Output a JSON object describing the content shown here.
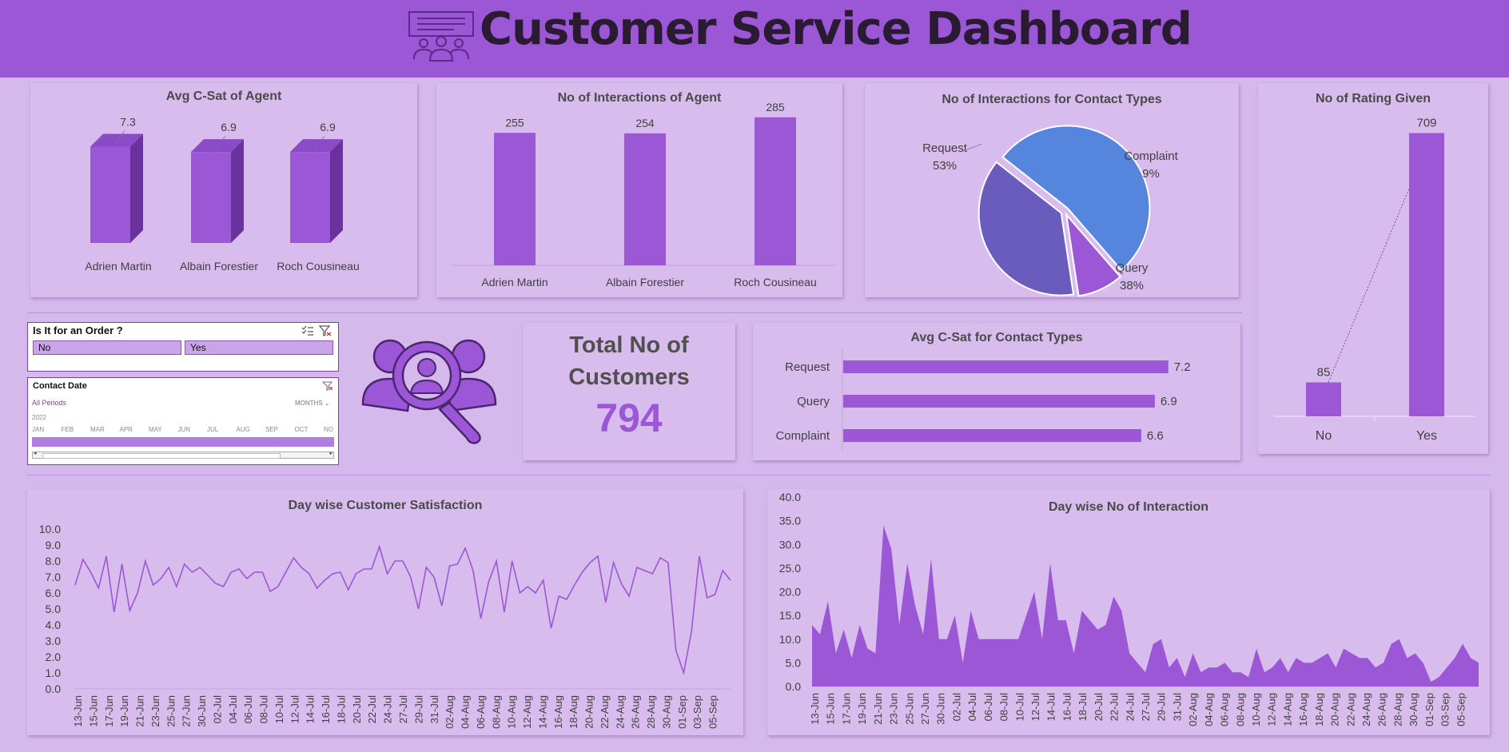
{
  "header": {
    "title": "Customer Service Dashboard",
    "logo_icon": "customer-service-icon"
  },
  "colors": {
    "header": "#9b57d6",
    "background": "#d6b9ec",
    "bar": "#9b57d6",
    "request": "#5585dc",
    "query": "#6a5cbc",
    "complaint": "#9b57d6"
  },
  "csat_agent": {
    "title": "Avg C-Sat of  Agent",
    "chart_data": {
      "type": "bar",
      "categories": [
        "Adrien Martin",
        "Albain Forestier",
        "Roch Cousineau"
      ],
      "values": [
        7.3,
        6.9,
        6.9
      ],
      "labels": [
        "7.3",
        "6.9",
        "6.9"
      ]
    }
  },
  "interactions_agent": {
    "title": "No of Interactions of  Agent",
    "chart_data": {
      "type": "bar",
      "categories": [
        "Adrien Martin",
        "Albain Forestier",
        "Roch Cousineau"
      ],
      "values": [
        255,
        254,
        285
      ],
      "labels": [
        "255",
        "254",
        "285"
      ]
    }
  },
  "contact_types": {
    "title": "No of Interactions for Contact Types",
    "chart_data": {
      "type": "pie",
      "slices": [
        {
          "name": "Request",
          "pct": 53,
          "label": "53%"
        },
        {
          "name": "Complaint",
          "pct": 9,
          "label": "9%"
        },
        {
          "name": "Query",
          "pct": 38,
          "label": "38%"
        }
      ]
    }
  },
  "rating": {
    "title": "No of Rating Given",
    "chart_data": {
      "type": "bar",
      "categories": [
        "No",
        "Yes"
      ],
      "values": [
        85,
        709
      ],
      "labels": [
        "85",
        "709"
      ]
    }
  },
  "order_slicer": {
    "title": "Is It for an Order ?",
    "options": [
      "No",
      "Yes"
    ]
  },
  "date_slicer": {
    "title": "Contact Date",
    "all_periods": "All Periods",
    "level": "MONTHS",
    "year": "2022",
    "months": [
      "JAN",
      "FEB",
      "MAR",
      "APR",
      "MAY",
      "JUN",
      "JUL",
      "AUG",
      "SEP",
      "OCT",
      "NO"
    ]
  },
  "kpi": {
    "line1": "Total  No of",
    "line2": "Customers",
    "value": "794",
    "icon": "customer-search-icon"
  },
  "csat_contact": {
    "title": "Avg C-Sat for Contact Types",
    "chart_data": {
      "type": "bar",
      "categories": [
        "Request",
        "Query",
        "Complaint"
      ],
      "values": [
        7.2,
        6.9,
        6.6
      ],
      "labels": [
        "7.2",
        "6.9",
        "6.6"
      ]
    }
  },
  "day_csat": {
    "title": "Day wise Customer Satisfaction",
    "chart_data": {
      "type": "line",
      "ylim": [
        0,
        10
      ],
      "y_ticks": [
        "10.0",
        "9.0",
        "8.0",
        "7.0",
        "6.0",
        "5.0",
        "4.0",
        "3.0",
        "2.0",
        "1.0",
        "0.0"
      ],
      "x_ticks": [
        "13-Jun",
        "15-Jun",
        "17-Jun",
        "19-Jun",
        "21-Jun",
        "23-Jun",
        "25-Jun",
        "27-Jun",
        "30-Jun",
        "02-Jul",
        "04-Jul",
        "06-Jul",
        "08-Jul",
        "10-Jul",
        "12-Jul",
        "14-Jul",
        "16-Jul",
        "18-Jul",
        "20-Jul",
        "22-Jul",
        "24-Jul",
        "27-Jul",
        "29-Jul",
        "31-Jul",
        "02-Aug",
        "04-Aug",
        "06-Aug",
        "08-Aug",
        "10-Aug",
        "12-Aug",
        "14-Aug",
        "16-Aug",
        "18-Aug",
        "20-Aug",
        "22-Aug",
        "24-Aug",
        "26-Aug",
        "28-Aug",
        "30-Aug",
        "01-Sep",
        "03-Sep",
        "05-Sep"
      ],
      "values": [
        6.5,
        8.1,
        7.3,
        6.3,
        8.3,
        4.8,
        7.8,
        4.9,
        6.0,
        8.0,
        6.5,
        6.9,
        7.6,
        6.4,
        7.8,
        7.3,
        7.6,
        7.1,
        6.6,
        6.4,
        7.3,
        7.5,
        6.9,
        7.3,
        7.3,
        6.1,
        6.4,
        7.3,
        8.2,
        7.6,
        7.2,
        6.3,
        6.8,
        7.2,
        7.3,
        6.2,
        7.2,
        7.5,
        7.5,
        8.9,
        7.2,
        8.0,
        8.0,
        7.0,
        5.0,
        7.6,
        7.0,
        5.2,
        7.7,
        7.8,
        8.8,
        7.4,
        4.4,
        6.7,
        8.0,
        4.8,
        8.0,
        6.0,
        6.4,
        6.0,
        6.8,
        3.8,
        5.8,
        5.6,
        6.5,
        7.3,
        7.9,
        8.3,
        5.4,
        7.9,
        6.6,
        5.8,
        7.6,
        7.4,
        7.2,
        8.2,
        7.9,
        2.4,
        1.0,
        3.6,
        8.3,
        5.7,
        5.9,
        7.4,
        6.8
      ]
    }
  },
  "day_interaction": {
    "title": "Day wise  No of Interaction",
    "chart_data": {
      "type": "area",
      "ylim": [
        0,
        40
      ],
      "y_ticks": [
        "40.0",
        "35.0",
        "30.0",
        "25.0",
        "20.0",
        "15.0",
        "10.0",
        "5.0",
        "0.0"
      ],
      "x_ticks": [
        "13-Jun",
        "15-Jun",
        "17-Jun",
        "19-Jun",
        "21-Jun",
        "23-Jun",
        "25-Jun",
        "27-Jun",
        "30-Jun",
        "02-Jul",
        "04-Jul",
        "06-Jul",
        "08-Jul",
        "10-Jul",
        "12-Jul",
        "14-Jul",
        "16-Jul",
        "18-Jul",
        "20-Jul",
        "22-Jul",
        "24-Jul",
        "27-Jul",
        "29-Jul",
        "31-Jul",
        "02-Aug",
        "04-Aug",
        "06-Aug",
        "08-Aug",
        "10-Aug",
        "12-Aug",
        "14-Aug",
        "16-Aug",
        "18-Aug",
        "20-Aug",
        "22-Aug",
        "24-Aug",
        "26-Aug",
        "28-Aug",
        "30-Aug",
        "01-Sep",
        "03-Sep",
        "05-Sep"
      ],
      "values": [
        13,
        11,
        18,
        7,
        12,
        6,
        13,
        8,
        7,
        34,
        29,
        13,
        26,
        17,
        11,
        27,
        10,
        10,
        15,
        5,
        16,
        10,
        10,
        10,
        10,
        10,
        10,
        15,
        20,
        10,
        26,
        14,
        14,
        7,
        16,
        14,
        12,
        13,
        19,
        16,
        7,
        5,
        3,
        9,
        10,
        4,
        6,
        2,
        7,
        3,
        4,
        4,
        5,
        3,
        3,
        2,
        8,
        3,
        4,
        6,
        3,
        6,
        5,
        5,
        6,
        7,
        4,
        8,
        7,
        6,
        6,
        4,
        5,
        9,
        10,
        6,
        7,
        5,
        1,
        2,
        4,
        6,
        9,
        6,
        5
      ]
    }
  }
}
